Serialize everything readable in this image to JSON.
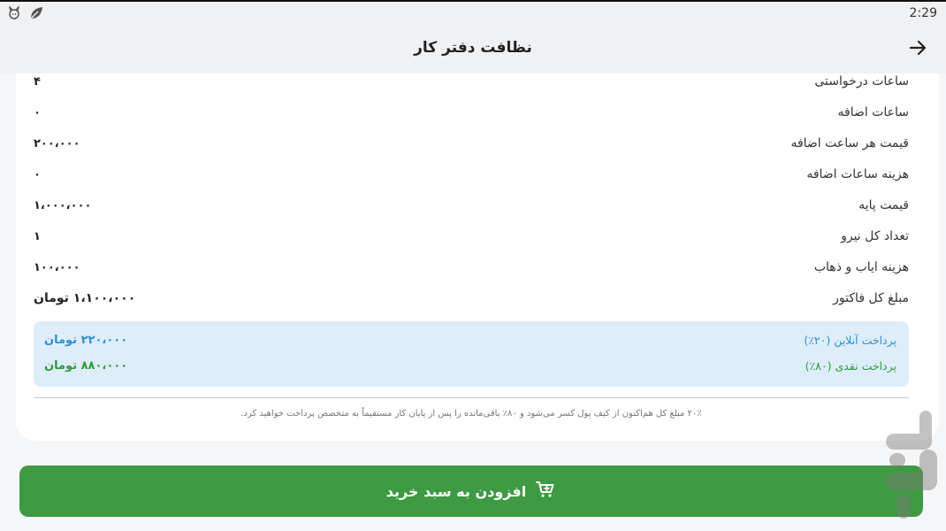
{
  "status_bar": {
    "time": "2:29",
    "icons": [
      "cat-icon",
      "leaf-icon"
    ]
  },
  "app_bar": {
    "title": "نظافت دفتر کار",
    "back_icon": "arrow-back-icon"
  },
  "invoice_rows": [
    {
      "label": "ساعات درخواستی",
      "value": "۴"
    },
    {
      "label": "ساعات اضافه",
      "value": "۰"
    },
    {
      "label": "قیمت هر ساعت اضافه",
      "value": "۲۰۰،۰۰۰"
    },
    {
      "label": "هزینه ساعات اضافه",
      "value": "۰"
    },
    {
      "label": "قیمت پایه",
      "value": "۱،۰۰۰،۰۰۰"
    },
    {
      "label": "تعداد کل نیرو",
      "value": "۱"
    },
    {
      "label": "هزینه ایاب و ذهاب",
      "value": "۱۰۰،۰۰۰"
    },
    {
      "label": "مبلغ کل فاکتور",
      "value": "۱،۱۰۰،۰۰۰ تومان"
    }
  ],
  "payment": {
    "online_label": "پرداخت آنلاین (۲۰٪)",
    "online_value": "۲۲۰،۰۰۰ تومان",
    "cash_label": "پرداخت نقدی (۸۰٪)",
    "cash_value": "۸۸۰،۰۰۰ تومان"
  },
  "note": "۲۰٪ مبلغ کل هم‌اکنون از کیف پول کسر می‌شود و ۸۰٪ باقی‌مانده را پس از پایان کار مستقیماً به متخصص پرداخت خواهید کرد.",
  "add_to_cart": {
    "label": "افزودن به سبد خرید",
    "icon": "cart-plus-icon"
  },
  "colors": {
    "primary_green": "#3e9a43",
    "online_blue": "#2b8fd6",
    "cash_green": "#2e9a3a",
    "payment_box_bg": "#deedfa"
  }
}
